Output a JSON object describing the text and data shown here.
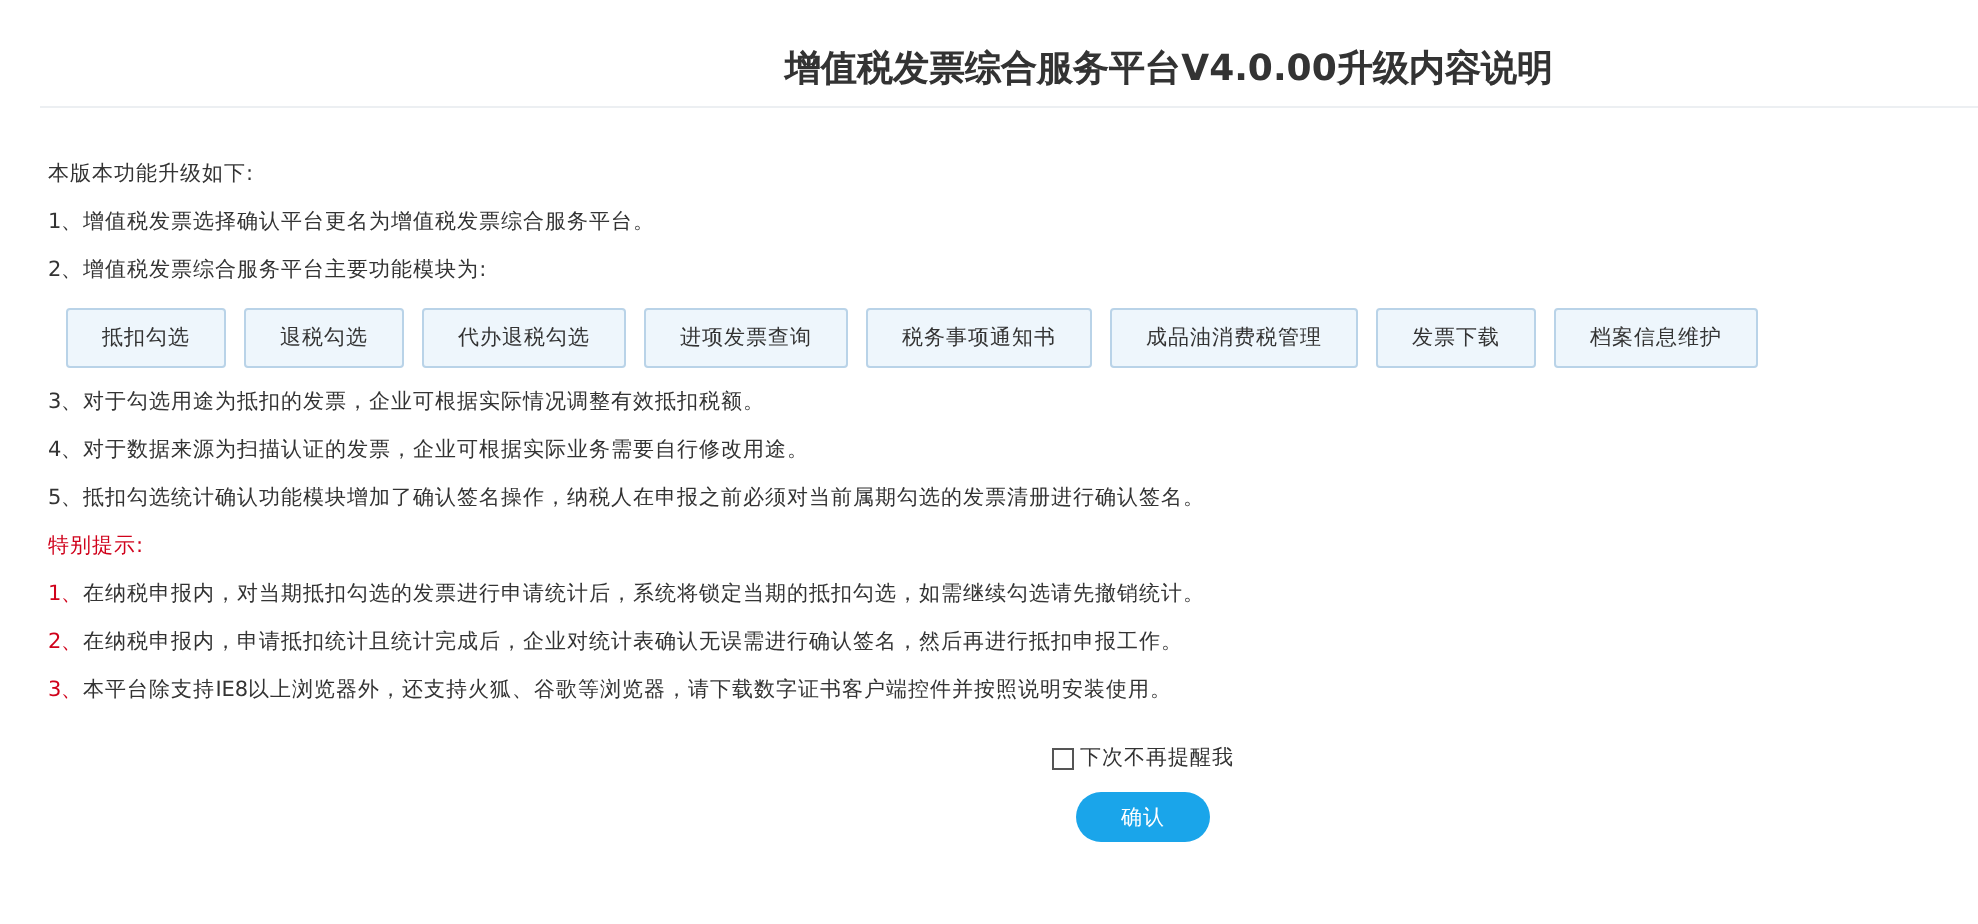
{
  "title": "增值税发票综合服务平台V4.0.00升级内容说明",
  "intro": "本版本功能升级如下:",
  "items_before": [
    "1、增值税发票选择确认平台更名为增值税发票综合服务平台。",
    "2、增值税发票综合服务平台主要功能模块为:"
  ],
  "modules": [
    "抵扣勾选",
    "退税勾选",
    "代办退税勾选",
    "进项发票查询",
    "税务事项通知书",
    "成品油消费税管理",
    "发票下载",
    "档案信息维护"
  ],
  "items_after": [
    "3、对于勾选用途为抵扣的发票，企业可根据实际情况调整有效抵扣税额。",
    "4、对于数据来源为扫描认证的发票，企业可根据实际业务需要自行修改用途。",
    "5、抵扣勾选统计确认功能模块增加了确认签名操作，纳税人在申报之前必须对当前属期勾选的发票清册进行确认签名。"
  ],
  "notice_heading": "特别提示:",
  "notices": [
    {
      "number": "1、",
      "text": "在纳税申报内，对当期抵扣勾选的发票进行申请统计后，系统将锁定当期的抵扣勾选，如需继续勾选请先撤销统计。"
    },
    {
      "number": "2、",
      "text": "在纳税申报内，申请抵扣统计且统计完成后，企业对统计表确认无误需进行确认签名，然后再进行抵扣申报工作。"
    },
    {
      "number": "3、",
      "text": "本平台除支持IE8以上浏览器外，还支持火狐、谷歌等浏览器，请下载数字证书客户端控件并按照说明安装使用。"
    }
  ],
  "dont_remind": {
    "label": "下次不再提醒我",
    "checked": false
  },
  "confirm_button": "确认"
}
